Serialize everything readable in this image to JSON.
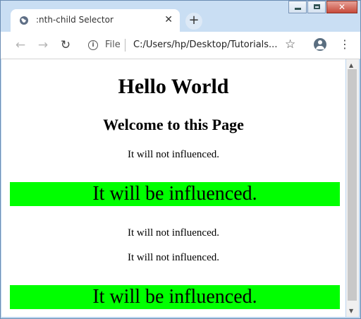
{
  "tab": {
    "title": ":nth-child Selector",
    "close": "✕"
  },
  "newtab": "+",
  "toolbar": {
    "back": "←",
    "forward": "→",
    "reload": "↻",
    "info": "i",
    "scheme": "File",
    "url": "C:/Users/hp/Desktop/Tutorials...",
    "star": "☆",
    "menu": "⋮"
  },
  "window_controls": {
    "close": "✕"
  },
  "page": {
    "heading": "Hello World",
    "subheading": "Welcome to this Page",
    "paragraphs": [
      "It will not influenced.",
      "It will be influenced.",
      "It will not influenced.",
      "It will not influenced.",
      "It will be influenced."
    ],
    "highlight_color": "#00ff00"
  }
}
